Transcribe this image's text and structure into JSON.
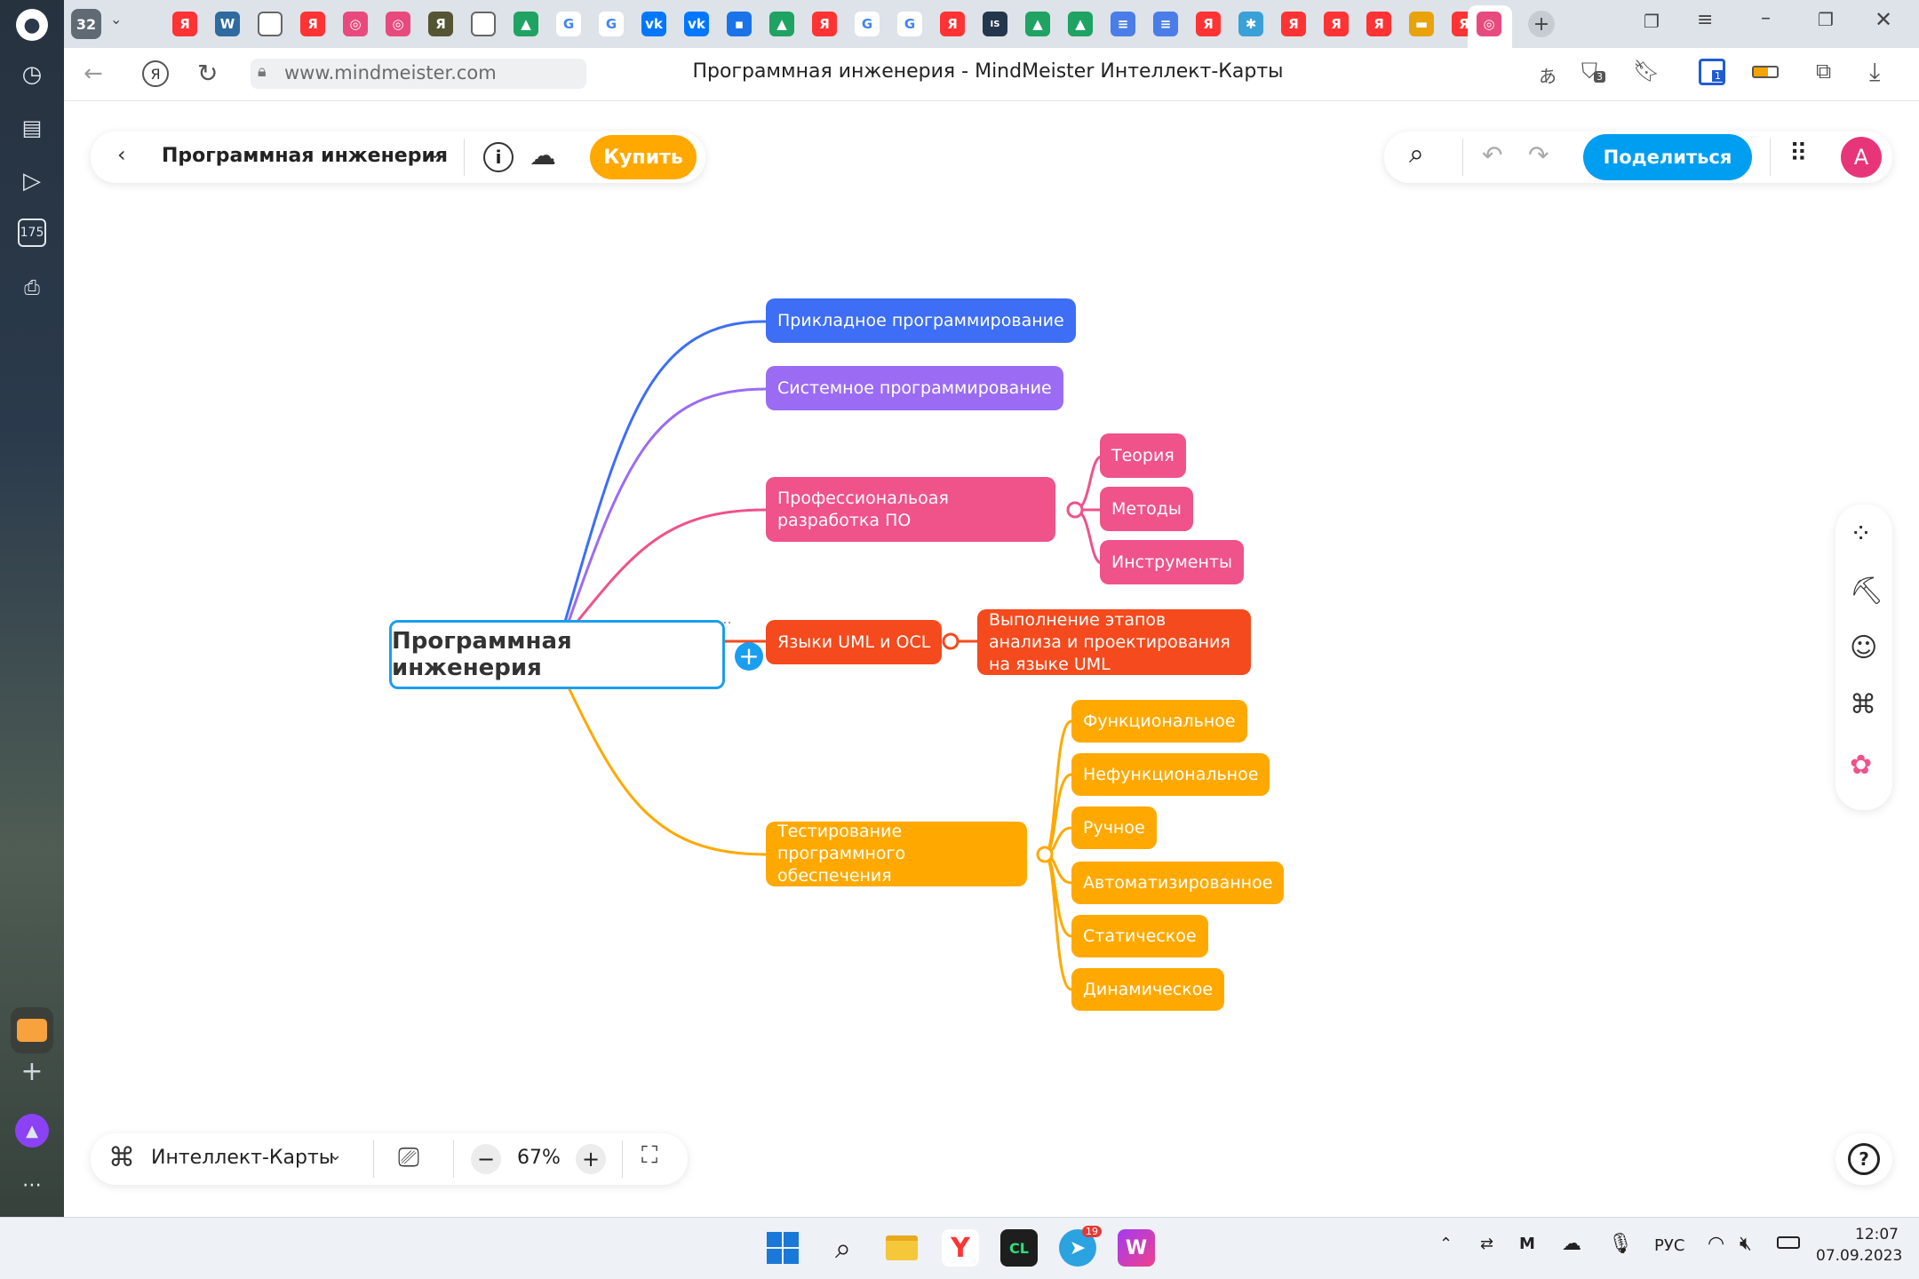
{
  "browser": {
    "tab_count": "32",
    "address": "www.mindmeister.com",
    "page_title": "Программная инженерия - MindMeister Интеллект-Карты",
    "sidebar_badge": "175",
    "extension_badge_1": "3",
    "extension_badge_2": "1"
  },
  "toolbar": {
    "map_title": "Программная инженерия",
    "buy_label": "Купить",
    "share_label": "Поделиться",
    "avatar_letter": "A"
  },
  "mindmap": {
    "root": "Программная инженерия",
    "branches": [
      {
        "label": "Прикладное программирование",
        "color": "#3d6ef5"
      },
      {
        "label": "Системное программирование",
        "color": "#9b6cf3"
      },
      {
        "label": "Профессиональоая разработка ПО",
        "color": "#f0528a",
        "children": [
          "Теория",
          "Методы",
          "Инструменты"
        ]
      },
      {
        "label": "Языки UML и OCL",
        "color": "#f44a1d",
        "children": [
          "Выполнение этапов анализа и проектирования на языке UML"
        ]
      },
      {
        "label": "Тестирование программного обеспечения",
        "color": "#ffa900",
        "children": [
          "Функциональное",
          "Нефункциональное",
          "Ручное",
          "Автоматизированное",
          "Статическое",
          "Динамическое"
        ]
      }
    ]
  },
  "bottombar": {
    "view_mode": "Интеллект-Карты",
    "zoom": "67%"
  },
  "taskbar": {
    "language": "РУС",
    "time": "12:07",
    "date": "07.09.2023",
    "telegram_badge": "19"
  }
}
